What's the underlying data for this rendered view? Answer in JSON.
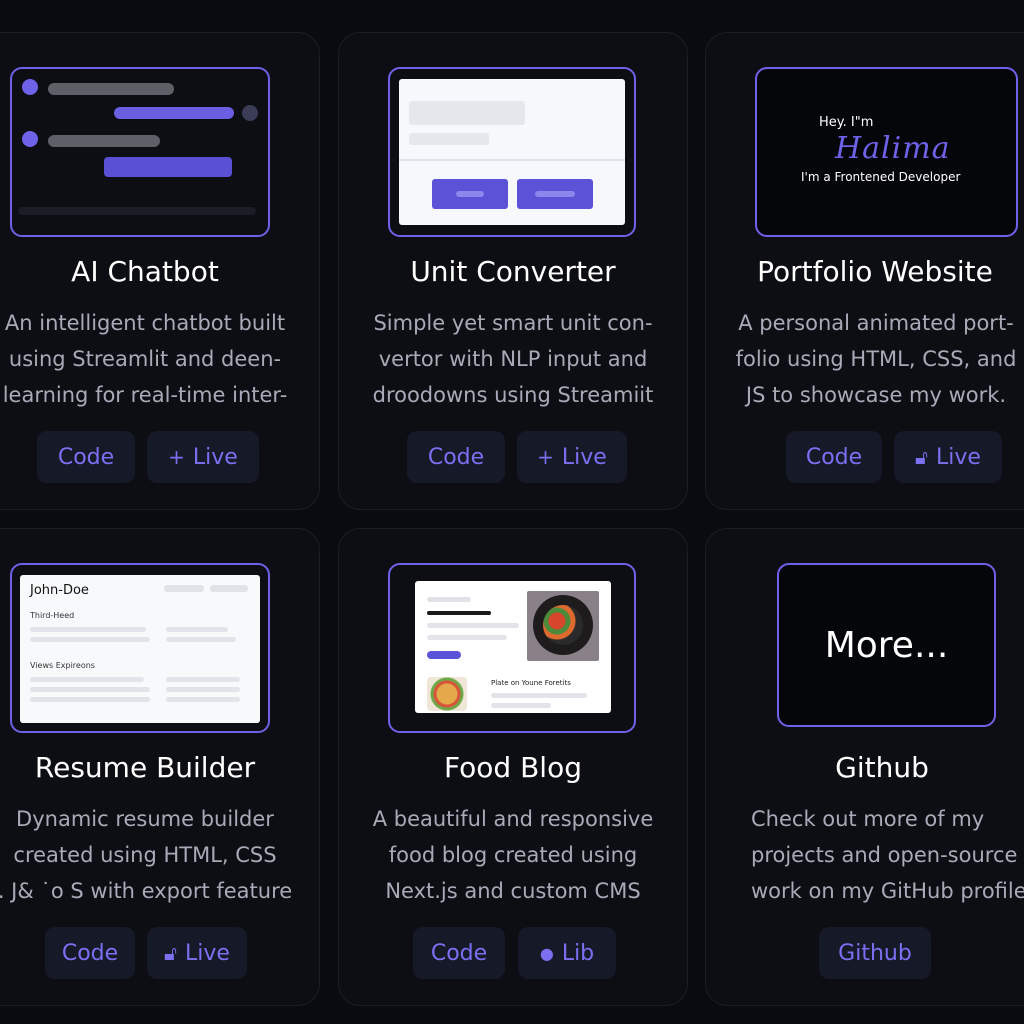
{
  "cards": [
    {
      "title": "AI Chatbot",
      "desc": [
        "An intelligent chatbot built",
        "using Streamlit and deen-",
        "learning for real-time inter-"
      ],
      "buttons": [
        {
          "label": "Code"
        },
        {
          "label": "Live",
          "icon": "plus-icon"
        }
      ]
    },
    {
      "title": "Unit Converter",
      "desc": [
        "Simple yet smart unit con-",
        "vertor with NLP input and",
        "droodowns using Streamiit"
      ],
      "buttons": [
        {
          "label": "Code"
        },
        {
          "label": "Live",
          "icon": "plus-icon"
        }
      ]
    },
    {
      "title": "Portfolio Website",
      "desc": [
        "A personal animated port-",
        "folio using HTML, CSS, and",
        "JS to showcase my work."
      ],
      "preview": {
        "greeting": "Hey. I\"m",
        "signature": "Halima",
        "subtitle": "I'm a Frontened Developer"
      },
      "buttons": [
        {
          "label": "Code"
        },
        {
          "label": "Live",
          "icon": "lock-icon"
        }
      ]
    },
    {
      "title": "Resume Builder",
      "desc": [
        "Dynamic resume builder",
        "created using HTML, CSS",
        ". J& ˙o S with export feature"
      ],
      "preview": {
        "name": "John-Doe",
        "section1": "Third-Heed",
        "section2": "Views Expireons"
      },
      "buttons": [
        {
          "label": "Code"
        },
        {
          "label": "Live",
          "icon": "lock-icon"
        }
      ]
    },
    {
      "title": "Food Blog",
      "desc": [
        "A beautiful and responsive",
        "food blog created using",
        "Next.js and custom CMS"
      ],
      "preview": {
        "caption": "Plate on Youne Foretits"
      },
      "buttons": [
        {
          "label": "Code"
        },
        {
          "label": "Lib",
          "icon": "cloud-icon"
        }
      ]
    },
    {
      "title": "Github",
      "desc": [
        "Check out more of my",
        "projects and open-source",
        "work on my GitHub profile"
      ],
      "preview": {
        "more": "More..."
      },
      "buttons": [
        {
          "label": "Github"
        }
      ]
    }
  ],
  "colors": {
    "background": "#090b10",
    "card": "#0c0e14",
    "accent": "#6e62e8",
    "button_bg": "#151928"
  }
}
